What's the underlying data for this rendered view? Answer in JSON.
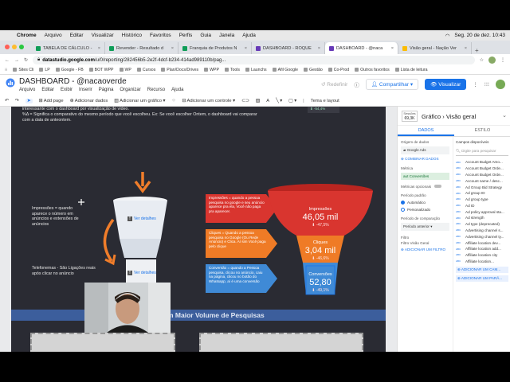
{
  "menubar": {
    "app": "Chrome",
    "items": [
      "Arquivo",
      "Editar",
      "Visualizar",
      "Histórico",
      "Favoritos",
      "Perfis",
      "Guia",
      "Janela",
      "Ajuda"
    ],
    "datetime": "Seg. 20 de dez.  10:43"
  },
  "tabs": [
    {
      "label": "TABELA DE CÁLCULO -",
      "color": "#0f9d58"
    },
    {
      "label": "Revender - Resultado d",
      "color": "#0f9d58"
    },
    {
      "label": "Franquia de Produtos N",
      "color": "#0f9d58"
    },
    {
      "label": "DASHBOARD - ROQUE",
      "color": "#673ab7"
    },
    {
      "label": "DASHBOARD - @naca",
      "color": "#673ab7",
      "active": true
    },
    {
      "label": "Visão geral - Nação Ver",
      "color": "#fbbc04"
    }
  ],
  "address": {
    "domain": "datastudio.google.com",
    "path": "/u/0/reporting/282456b5-2e2f-4dcf-b234-414ad989110b/pag..."
  },
  "bookmarks": [
    "Sites Cli",
    "LP",
    "Google - FB",
    "BOT WPP",
    "WP",
    "Cursos",
    "Plan/Docs/Drives",
    "WPP",
    "Tools",
    "Launchs",
    "Afil Google",
    "Gestão",
    "Co-Prod",
    "Outros favoritos",
    "Lista de leitura"
  ],
  "app": {
    "title": "DASHBOARD - @nacaoverde",
    "menus": [
      "Arquivo",
      "Editar",
      "Exibir",
      "Inserir",
      "Página",
      "Organizar",
      "Recurso",
      "Ajuda"
    ],
    "redo": "Redefinir",
    "share": "Compartilhar",
    "view": "Visualizar"
  },
  "toolbar": {
    "add_page": "Add page",
    "add_data": "Adicionar dados",
    "add_chart": "Adicionar um gráfico",
    "add_control": "Adicionar um controle",
    "theme": "Tema e layout"
  },
  "report": {
    "intro_line1": "interessante com o dashboard por visualização de vídeo.",
    "intro_line2": "%Δ = Significa o comparativo do mesmo período que você escolheu. Ex: Se você escolher Ontem, o dashboard vai comparar",
    "intro_line3": "com a data de anteontem.",
    "top_stat": "⬇ -54,4%",
    "impressions_desc": "Impressões = quando aparece o número em anúncios e extensões de anúncios",
    "phones_desc": "Telefonemas - São Ligações reais após clicar no anúncio",
    "see_details": "Ver detalhes",
    "imp_label_text": "Impressões = quando a pessoa pesquisa no google e seu anúncio aparece pra ela, Você não paga pra aparecer.",
    "click_label_text": "Cliques = Quando a pessoa pesquisa no Google (Ou Rede Anúncio) e Clica. Aí sim Você paga pelo clique",
    "conv_label_text": "Conversão = quando a Pessoa pesquisa, clicou no anúncio, caiu na página, clicou no botão do Whatsapp, aí é uma conversão",
    "funnel": [
      {
        "title": "Impressões",
        "value": "46,05 mil",
        "delta": "⬇ -47,5%"
      },
      {
        "title": "Cliques",
        "value": "3,04 mil",
        "delta": "⬇ -46,6%"
      },
      {
        "title": "Conversões",
        "value": "52,80",
        "delta": "⬇ -49,1%"
      }
    ],
    "band_title": "m Maior Volume de Pesquisas"
  },
  "panel": {
    "chip_top": "Sessões",
    "chip_value": "69,3K",
    "breadcrumb": "Gráfico  ›  Visão geral",
    "tab_data": "DADOS",
    "tab_style": "ESTILO",
    "source_label": "Origem de dados",
    "source_value": "Google Ads",
    "combine": "COMBINAR DADOS",
    "metric_label": "Métrica",
    "metric_value": "Conversões",
    "optional_metrics": "Métricas opcionais",
    "default_period": "Período padrão",
    "auto": "Automático",
    "custom": "Personalizado",
    "compare_label": "Período de comparação",
    "compare_value": "Período anterior",
    "filter_label": "Filtro",
    "filter_sub": "Filtro Visão Geral",
    "add_filter": "ADICIONAR UM FILTRO",
    "available_fields": "Campos disponíveis",
    "search_placeholder": "Digite para pesquisar",
    "fields": [
      "Account Budget Amo...",
      "Account Budget Orde...",
      "Account Budget Orde...",
      "Account name / desc...",
      "Ad Group Bid Strategy",
      "Ad group ID",
      "Ad group type",
      "Ad ID",
      "Ad policy approval sta...",
      "Ad strength",
      "Ad type (deprecated)",
      "Advertising channel s...",
      "Advertising channel ty...",
      "Affiliate location dev...",
      "Affiliate location add...",
      "Affiliate location city",
      "Affiliate location..."
    ],
    "add_field": "ADICIONAR UM CAM...",
    "add_param": "ADICIONAR UM PARÂ..."
  }
}
